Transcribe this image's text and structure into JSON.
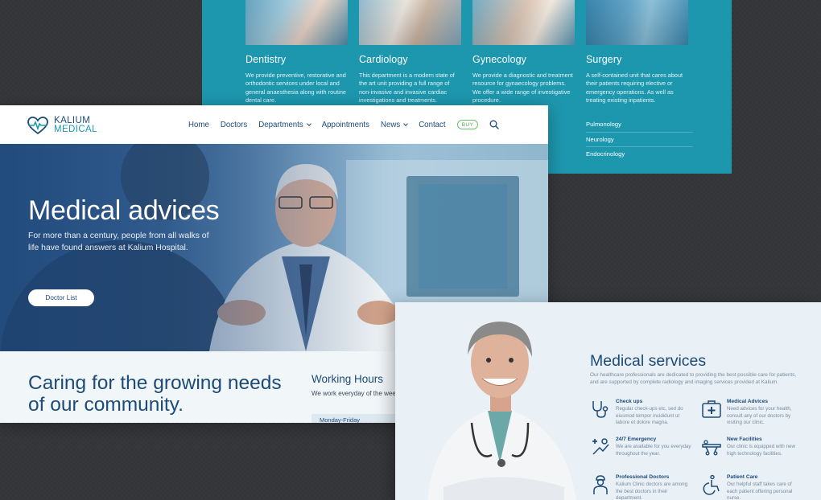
{
  "departments": [
    {
      "title": "Dentistry",
      "text": "We provide preventive, restorative and orthodontic services under local and general anaesthesia along with routine dental care.",
      "photo_color": "#4c8fb0"
    },
    {
      "title": "Cardiology",
      "text": "This department is a modern state of the art unit providing a full range of non-invasive and invasive cardiac investigations and treatments.",
      "photo_color": "#8fb2c6"
    },
    {
      "title": "Gynecology",
      "text": "We provide a diagnostic and treatment resource for gynaecology problems. We offer a wide range of investigative procedure.",
      "photo_color": "#6aa5bf"
    },
    {
      "title": "Surgery",
      "text": "A self-contained unit that cares about their patients requiring elective or emergency operations. As well as treating existing inpatients.",
      "photo_color": "#3f8fb3"
    }
  ],
  "department_links": [
    "Pulmonology",
    "Neurology",
    "Endocrinology"
  ],
  "logo": {
    "line1": "KALIUM",
    "line2": "MEDICAL"
  },
  "nav": {
    "items": [
      {
        "label": "Home",
        "dropdown": false
      },
      {
        "label": "Doctors",
        "dropdown": false
      },
      {
        "label": "Departments",
        "dropdown": true
      },
      {
        "label": "Appointments",
        "dropdown": false
      },
      {
        "label": "News",
        "dropdown": true
      },
      {
        "label": "Contact",
        "dropdown": false
      }
    ],
    "buy_label": "BUY",
    "search_icon": "search-icon"
  },
  "hero": {
    "title": "Medical advices",
    "subtitle": "For more than a century, people from all walks of life have found answers at Kalium Hospital.",
    "button_label": "Doctor List"
  },
  "community": {
    "heading": "Caring for the growing needs of our community.",
    "working_hours_title": "Working Hours",
    "working_hours_sub": "We work everyday of the wee",
    "first_row": "Monday-Friday"
  },
  "services": {
    "title": "Medical services",
    "description": "Our healthcare professionals are dedicated to providing the best possible care for patients, and are supported by complete radiology and imaging services provided at Kalium.",
    "items": [
      {
        "name": "Check ups",
        "text": "Regular check-ups etc, sed do eiusmod tempor incididunt ut labore et dolore magna.",
        "icon": "stethoscope-icon"
      },
      {
        "name": "Medical Advices",
        "text": "Need advices for your health, consult any of our doctors by visiting our clinic.",
        "icon": "medical-kit-icon"
      },
      {
        "name": "24/7 Emergency",
        "text": "We are available for you everyday throughout the year.",
        "icon": "emergency-icon"
      },
      {
        "name": "New Facilities",
        "text": "Our clinic is equipped with new high technology facilities.",
        "icon": "stretcher-icon"
      },
      {
        "name": "Professional Doctors",
        "text": "Kalium Clinic doctors are among the best doctors in their department.",
        "icon": "doctor-icon"
      },
      {
        "name": "Patient Care",
        "text": "Our helpful staff takes care of each patient offering personal nurse.",
        "icon": "wheelchair-icon"
      }
    ]
  },
  "colors": {
    "teal": "#1d97ae",
    "navy": "#1d4b78",
    "buy_green": "#4caf50",
    "background": "#333538"
  }
}
